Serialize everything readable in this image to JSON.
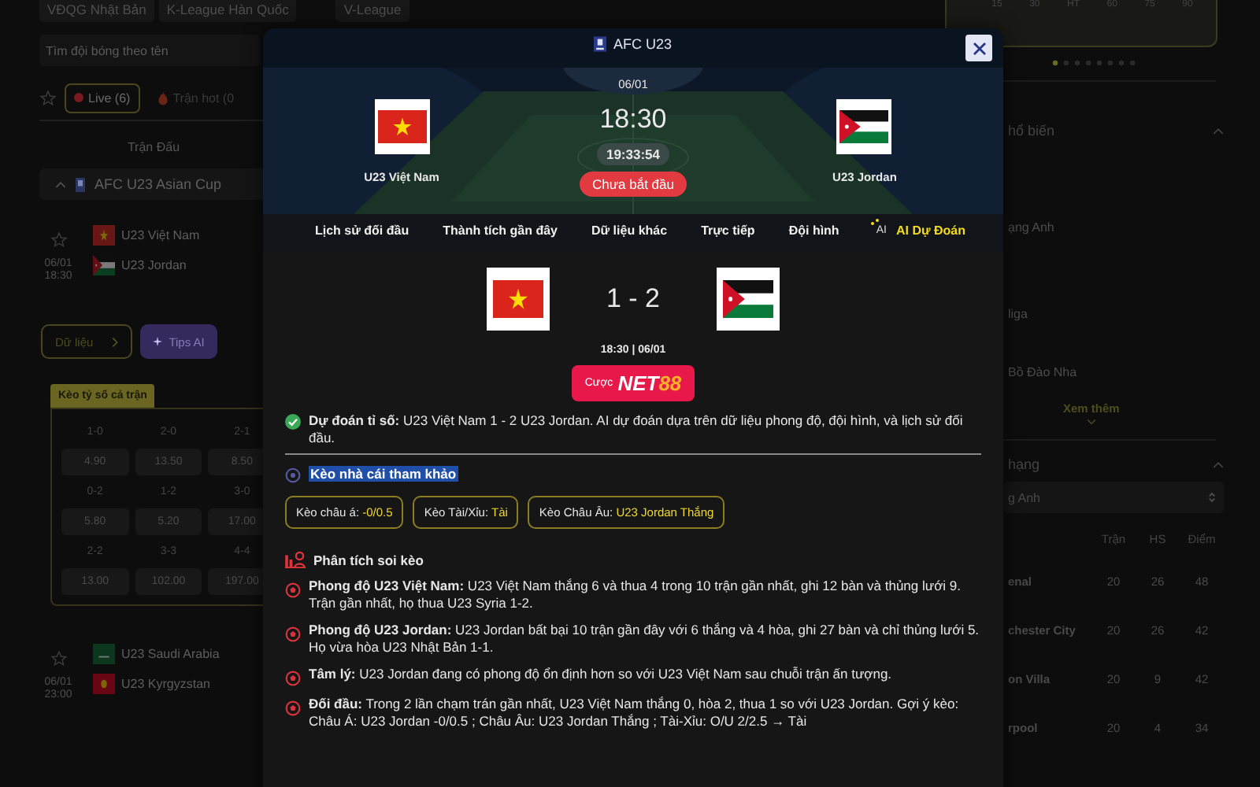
{
  "background": {
    "league_tabs": [
      "VĐQG Nhật Bản",
      "K-League Hàn Quốc",
      "V-League"
    ],
    "search": {
      "placeholder": "Tìm đội bóng theo tên"
    },
    "filters": [
      {
        "label": "Live (6)",
        "kind": "live",
        "selected": true
      },
      {
        "label": "Trận hot (0",
        "kind": "hot",
        "selected": false
      }
    ],
    "column_header": "Trận Đấu",
    "league": "AFC U23 Asian Cup",
    "matches": [
      {
        "date": "06/01",
        "time": "18:30",
        "home": "U23 Việt Nam",
        "away": "U23 Jordan"
      },
      {
        "date": "06/01",
        "time": "23:00",
        "home": "U23 Saudi Arabia",
        "away": "U23 Kyrgyzstan"
      }
    ],
    "actions": [
      {
        "label": "Dữ liệu",
        "kind": "data"
      },
      {
        "label": "Tips AI",
        "kind": "ai"
      }
    ],
    "odds_tab": "Kèo tỷ số cả trận",
    "score_odds": [
      {
        "score": "1-0",
        "odds": "4.90"
      },
      {
        "score": "2-0",
        "odds": "13.50"
      },
      {
        "score": "2-1",
        "odds": "8.50"
      },
      {
        "score": "0-2",
        "odds": "5.80"
      },
      {
        "score": "1-2",
        "odds": "5.20"
      },
      {
        "score": "3-0",
        "odds": "17.00"
      },
      {
        "score": "2-2",
        "odds": "13.00"
      },
      {
        "score": "3-3",
        "odds": "102.00"
      },
      {
        "score": "4-4",
        "odds": "197.00"
      }
    ]
  },
  "right_panel": {
    "timeline_labels": [
      "15",
      "30",
      "HT",
      "60",
      "75",
      "90"
    ],
    "popular_title": "hổ biến",
    "popular_items": [
      "ạng Anh",
      "liga",
      "Bồ Đào Nha"
    ],
    "more": "Xem thêm",
    "standings_title": "hạng",
    "standings_select": "g Anh",
    "standings_columns": [
      "Trận",
      "HS",
      "Điểm"
    ],
    "standings_rows": [
      {
        "team": "enal",
        "played": "20",
        "goal_diff": "26",
        "points": "48"
      },
      {
        "team": "chester City",
        "played": "20",
        "goal_diff": "26",
        "points": "42"
      },
      {
        "team": "on Villa",
        "played": "20",
        "goal_diff": "9",
        "points": "42"
      },
      {
        "team": "rpool",
        "played": "20",
        "goal_diff": "4",
        "points": "34"
      }
    ]
  },
  "modal": {
    "title": "AFC U23",
    "date": "06/01",
    "time": "18:30",
    "countdown": "19:33:54",
    "status": "Chưa bắt đầu",
    "home": {
      "name": "U23 Việt Nam"
    },
    "away": {
      "name": "U23 Jordan"
    },
    "tabs": [
      {
        "label": "Lịch sử đối đầu",
        "selected": false
      },
      {
        "label": "Thành tích gần đây",
        "selected": false
      },
      {
        "label": "Dữ liệu khác",
        "selected": false
      },
      {
        "label": "Trực tiếp",
        "selected": false
      },
      {
        "label": "Đội hình",
        "selected": false
      },
      {
        "label": "AI Dự Đoán",
        "badge": "AI",
        "selected": true
      }
    ],
    "prediction": {
      "score": "1 - 2",
      "datetime": "18:30 | 06/01",
      "bet_prefix": "Cược",
      "bet_brand": "NET",
      "bet_brand_accent": "88",
      "summary": "**Dự đoán tỉ số:** U23 Việt Nam 1 - 2 U23 Jordan. AI dự đoán dựa trên dữ liệu phong độ, đội hình, và lịch sử đối đầu."
    },
    "odds_title": "Kèo nhà cái tham khảo",
    "odds": [
      {
        "label": "Kèo châu á:",
        "value": "-0/0.5"
      },
      {
        "label": "Kèo Tài/Xỉu:",
        "value": "Tài"
      },
      {
        "label": "Kèo Châu Âu:",
        "value": "U23 Jordan Thắng"
      }
    ],
    "analysis_title": "Phân tích soi kèo",
    "analysis": [
      "**Phong độ U23 Việt Nam:** U23 Việt Nam thắng 6 và thua 4 trong 10 trận gần nhất, ghi 12 bàn và thủng lưới 9. Trận gần nhất, họ thua U23 Syria 1-2.",
      "**Phong độ U23 Jordan:** U23 Jordan bất bại 10 trận gần đây với 6 thắng và 4 hòa, ghi 27 bàn và chỉ thủng lưới 5. Họ vừa hòa U23 Nhật Bản 1-1.",
      "**Tâm lý:** U23 Jordan đang có phong độ ổn định hơn so với U23 Việt Nam sau chuỗi trận ấn tượng.",
      "**Đối đầu:** Trong 2 lần chạm trán gần nhất, U23 Việt Nam thắng 0, hòa 2, thua 1 so với U23 Jordan. Gợi ý kèo: Châu Á: U23 Jordan -0/0.5 ; Châu Âu: U23 Jordan Thắng ; Tài-Xỉu: O/U 2/2.5 → Tài"
    ]
  }
}
